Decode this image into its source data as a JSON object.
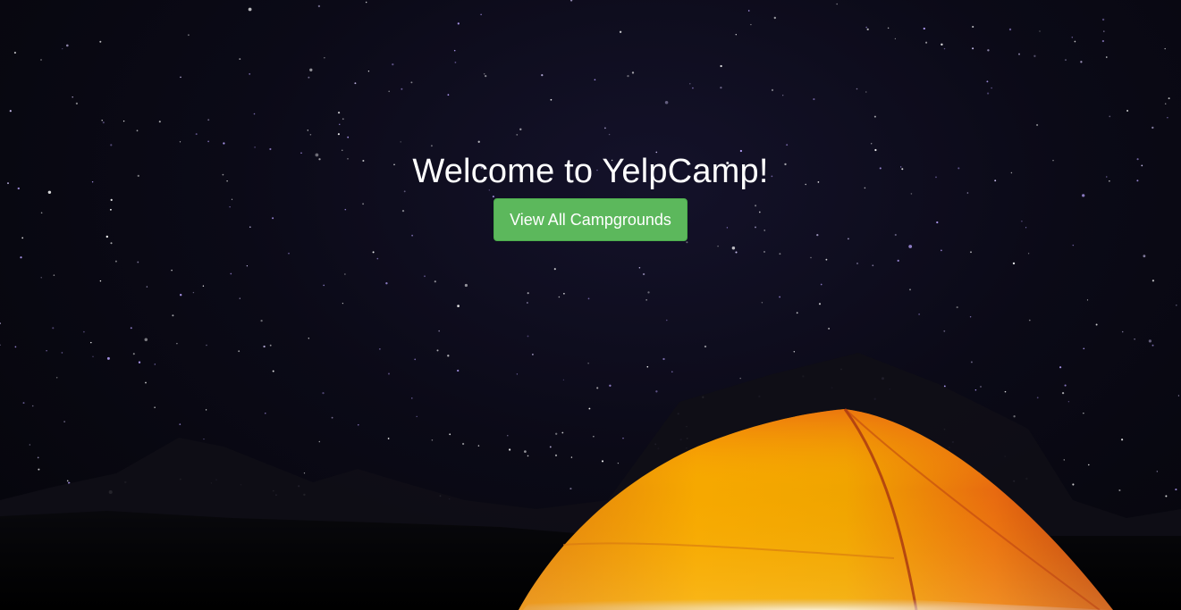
{
  "hero": {
    "title": "Welcome to YelpCamp!",
    "button_label": "View All Campgrounds",
    "button_color": "#5cb85c"
  },
  "background": {
    "scene": "starry-night-tent",
    "tent_colors": [
      "#f5a300",
      "#e86a10",
      "#c73a12"
    ]
  }
}
